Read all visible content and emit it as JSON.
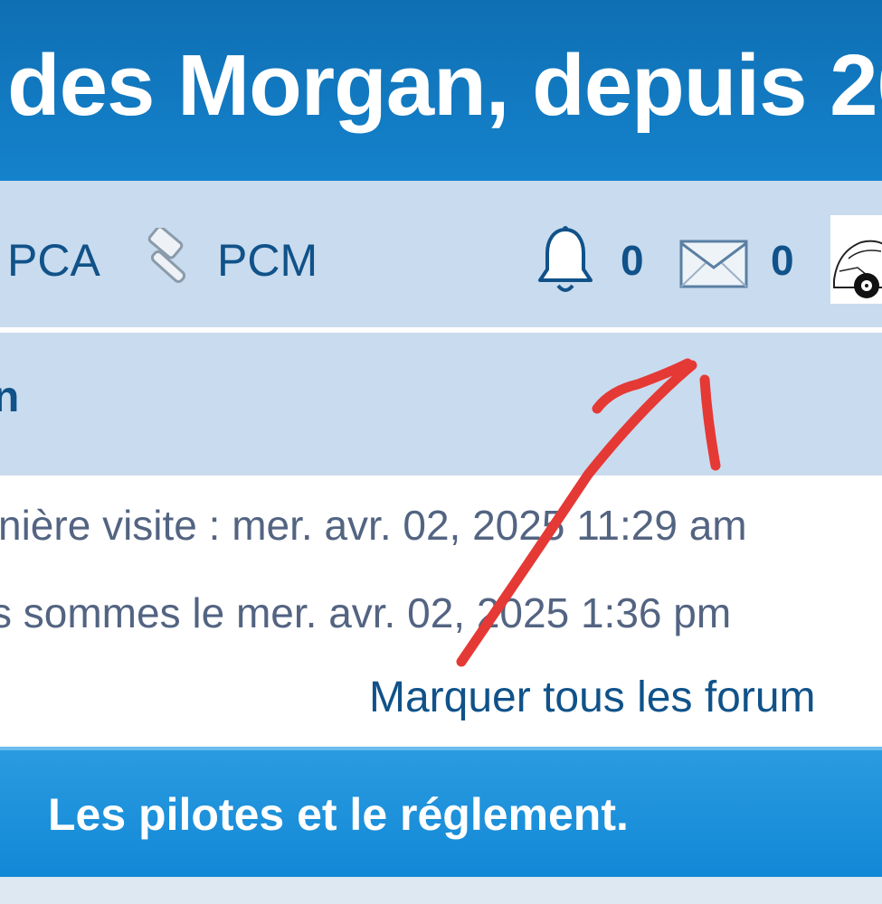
{
  "header": {
    "site_title": "des Morgan, depuis 20"
  },
  "navbar": {
    "links": [
      {
        "label": "PCA"
      },
      {
        "label": "PCM",
        "icon": "gavel-icon"
      }
    ],
    "notifications": {
      "icon": "bell-icon",
      "count": "0"
    },
    "messages": {
      "icon": "envelope-icon",
      "count": "0"
    },
    "avatar": {
      "icon": "car-sketch-avatar"
    }
  },
  "breadcrumb": {
    "text": "n"
  },
  "info": {
    "last_visit": "nière visite : mer. avr. 02, 2025 11:29 am",
    "current_time": "s sommes le mer. avr. 02, 2025 1:36 pm",
    "mark_read": "Marquer tous les forum"
  },
  "forum_section": {
    "title": "Les pilotes et le réglement."
  },
  "colors": {
    "header_blue": "#1482cc",
    "nav_bg": "#c9dbee",
    "link_blue": "#105289",
    "text_gray": "#536482",
    "annotation_red": "#e53935"
  }
}
